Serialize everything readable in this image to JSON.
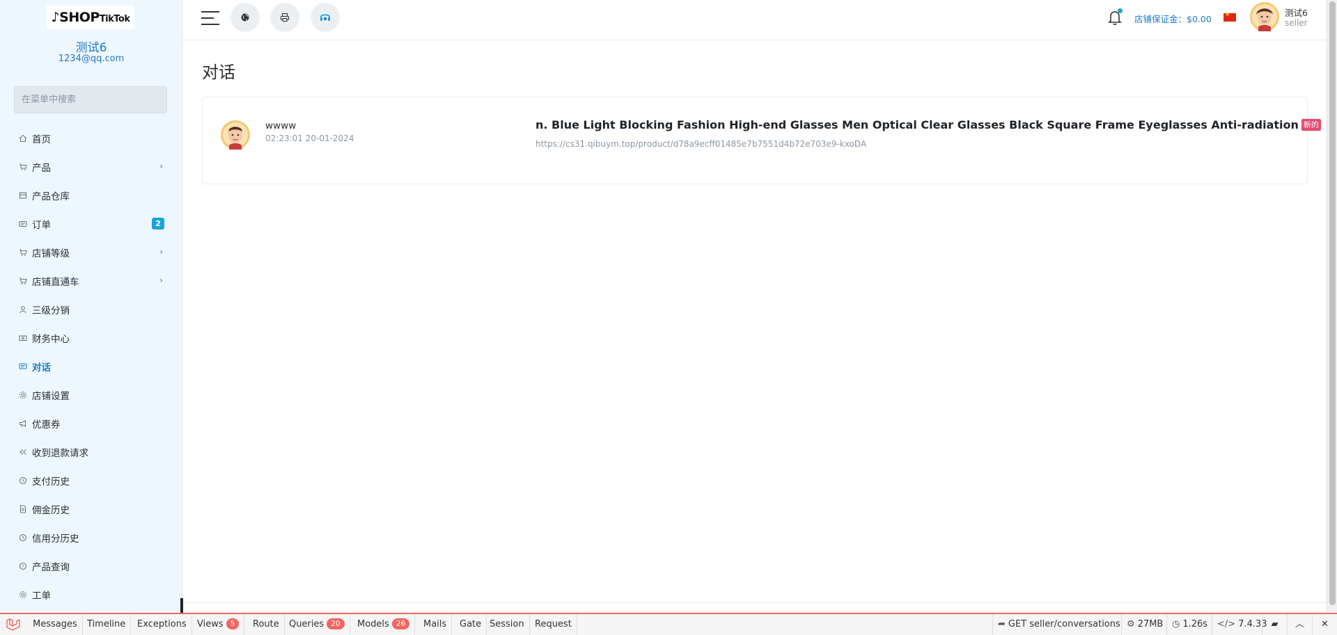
{
  "sidebar": {
    "logo": {
      "main": "SHOP",
      "sub": "TikTok"
    },
    "profile": {
      "name": "测试6",
      "email": "1234@qq.com"
    },
    "search_placeholder": "在菜单中搜索",
    "items": [
      {
        "label": "首页",
        "icon": "home-icon"
      },
      {
        "label": "产品",
        "icon": "cart-icon",
        "has_submenu": true
      },
      {
        "label": "产品仓库",
        "icon": "warehouse-icon"
      },
      {
        "label": "订单",
        "icon": "order-icon",
        "badge": "2"
      },
      {
        "label": "店铺等级",
        "icon": "cart-icon",
        "has_submenu": true
      },
      {
        "label": "店铺直通车",
        "icon": "cart-icon",
        "has_submenu": true
      },
      {
        "label": "三级分销",
        "icon": "user-icon"
      },
      {
        "label": "财务中心",
        "icon": "money-icon"
      },
      {
        "label": "对话",
        "icon": "chat-icon",
        "active": true
      },
      {
        "label": "店铺设置",
        "icon": "gear-icon"
      },
      {
        "label": "优惠券",
        "icon": "megaphone-icon"
      },
      {
        "label": "收到退款请求",
        "icon": "rewind-icon"
      },
      {
        "label": "支付历史",
        "icon": "history-icon"
      },
      {
        "label": "佣金历史",
        "icon": "document-icon"
      },
      {
        "label": "信用分历史",
        "icon": "history-icon"
      },
      {
        "label": "产品查询",
        "icon": "help-icon"
      },
      {
        "label": "工单",
        "icon": "gear-icon"
      }
    ]
  },
  "topbar": {
    "deposit_label": "店铺保证金：$0.00",
    "user": {
      "name": "测试6",
      "role": "seller"
    }
  },
  "main": {
    "title": "对话",
    "conversations": [
      {
        "name": "wwww",
        "time": "02:23:01 20-01-2024",
        "product": "n. Blue Light Blocking Fashion High-end Glasses Men Optical Clear Glasses Black Square Frame Eyeglasses Anti-radiation",
        "badge": "新的",
        "url": "https://cs31.qibuym.top/product/d78a9ecff01485e7b7551d4b72e703e9-kxoDA"
      }
    ]
  },
  "debugbar": {
    "tabs": [
      {
        "label": "Messages"
      },
      {
        "label": "Timeline"
      },
      {
        "label": "Exceptions"
      },
      {
        "label": "Views",
        "count": "5"
      },
      {
        "label": "Route"
      },
      {
        "label": "Queries",
        "count": "20"
      },
      {
        "label": "Models",
        "count": "26"
      },
      {
        "label": "Mails"
      },
      {
        "label": "Gate"
      },
      {
        "label": "Session"
      },
      {
        "label": "Request"
      }
    ],
    "request": "GET seller/conversations",
    "memory": "27MB",
    "duration": "1.26s",
    "php_version": "7.4.33"
  },
  "colors": {
    "accent": "#1e7ac7",
    "badge": "#1aa3d8",
    "new_badge": "#e54b6b",
    "debug_red": "#f4645f"
  }
}
